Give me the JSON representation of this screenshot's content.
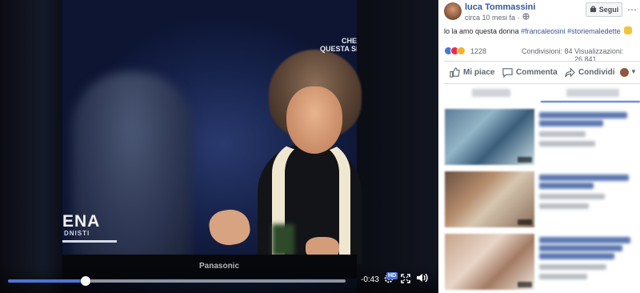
{
  "video": {
    "overlay_top_line1": "CHE",
    "overlay_top_line2": "QUESTA SE",
    "overlay_left": "ENA",
    "overlay_left_sub": "DNISTI",
    "tv_brand": "Panasonic",
    "progress": 0.23,
    "time_remaining": "-0:43",
    "hd_badge": "HD"
  },
  "post": {
    "author": "luca Tommassini",
    "timestamp": "circa 10 mesi fa",
    "follow_label": "Segui",
    "text_plain": "lo la amo questa donna ",
    "hashtag1": "#francaleosini",
    "hashtag2": "#storiemaledette",
    "reaction_count": "1228",
    "shares": "Condivisioni: 84",
    "views": "Visualizzazioni: 26.841",
    "actions": {
      "like": "Mi piace",
      "comment": "Commenta",
      "share": "Condividi"
    }
  },
  "colors": {
    "accent": "#4a76d6",
    "link": "#385898",
    "panel_bg": "#ffffff"
  }
}
